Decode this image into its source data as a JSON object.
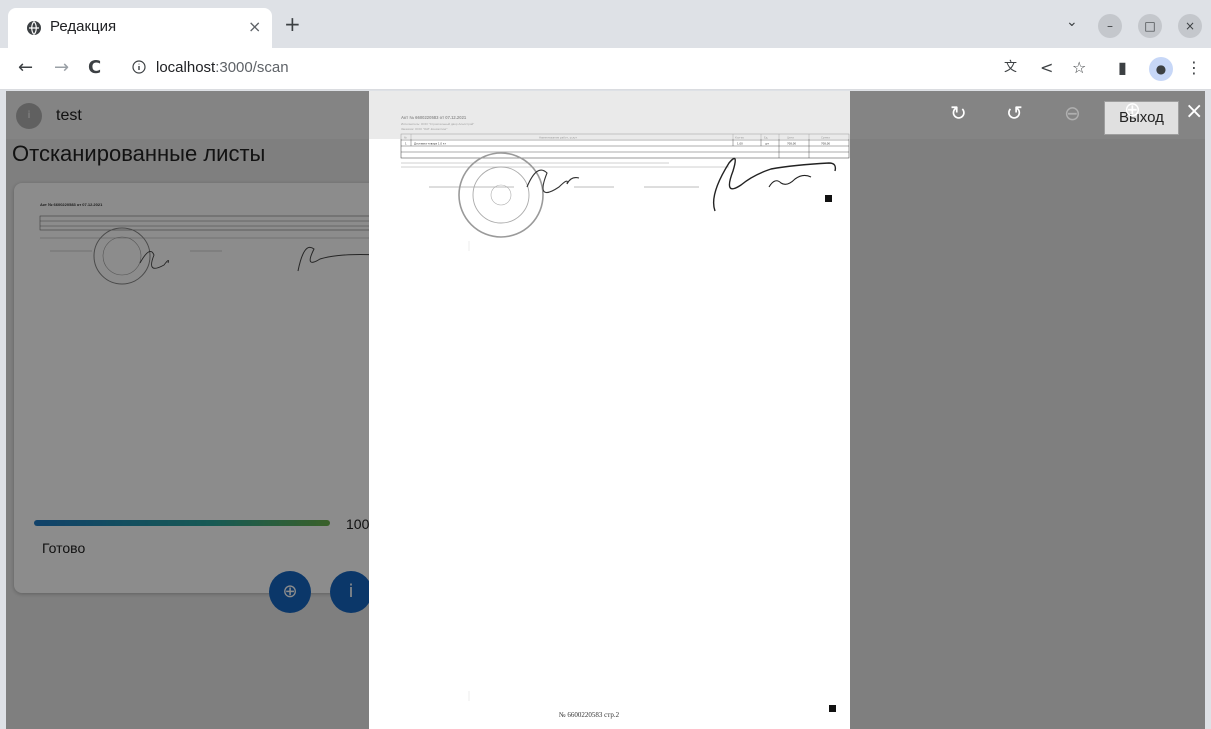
{
  "browser": {
    "tab_title": "Редакция",
    "tab_close": "×",
    "new_tab": "+",
    "url_host": "localhost",
    "url_path": ":3000/scan",
    "window": {
      "minimize": "–",
      "maximize": "□",
      "close": "×",
      "dropdown": "⌄"
    },
    "nav": {
      "back": "←",
      "forward": "→",
      "reload": "C"
    },
    "icons": {
      "translate": "文",
      "share": "<",
      "star": "☆",
      "sidepanel": "▮",
      "menu": "⋮",
      "profile": "●"
    }
  },
  "app": {
    "user_avatar": "i",
    "user_name": "test",
    "page_title": "Отсканированные листы",
    "card": {
      "progress_percent": 100,
      "progress_label": "100%",
      "status": "Готово"
    },
    "fab_zoom_icon": "⊕",
    "fab_info_icon": "i"
  },
  "viewer": {
    "rotate_right_icon": "↻",
    "rotate_left_icon": "↺",
    "zoom_out_icon": "⊖",
    "zoom_in_icon": "⊕",
    "exit_label": "Выход",
    "close_icon": "×"
  },
  "document": {
    "heading": "Акт № 6600220583 от 07.12.2021",
    "executor_line": "Исполнитель: ООО \"Строительный двор Альпстрой\"",
    "customer_line": "Заказчик: ООО \"ОАТ-Консалтинг\"",
    "table_headers": [
      "№",
      "Наименование работ, услуг",
      "Кол-во",
      "Ед.",
      "Цена",
      "Сумма"
    ],
    "row": [
      "1",
      "Доставка товара 1.0 кт",
      "1,00",
      "шт",
      "708,00",
      "708,00"
    ],
    "footer": "№ 6600220583 стр.2"
  },
  "colors": {
    "accent": "#1565c0",
    "progress_start": "#1f78c1",
    "progress_end": "#6ab04c"
  }
}
